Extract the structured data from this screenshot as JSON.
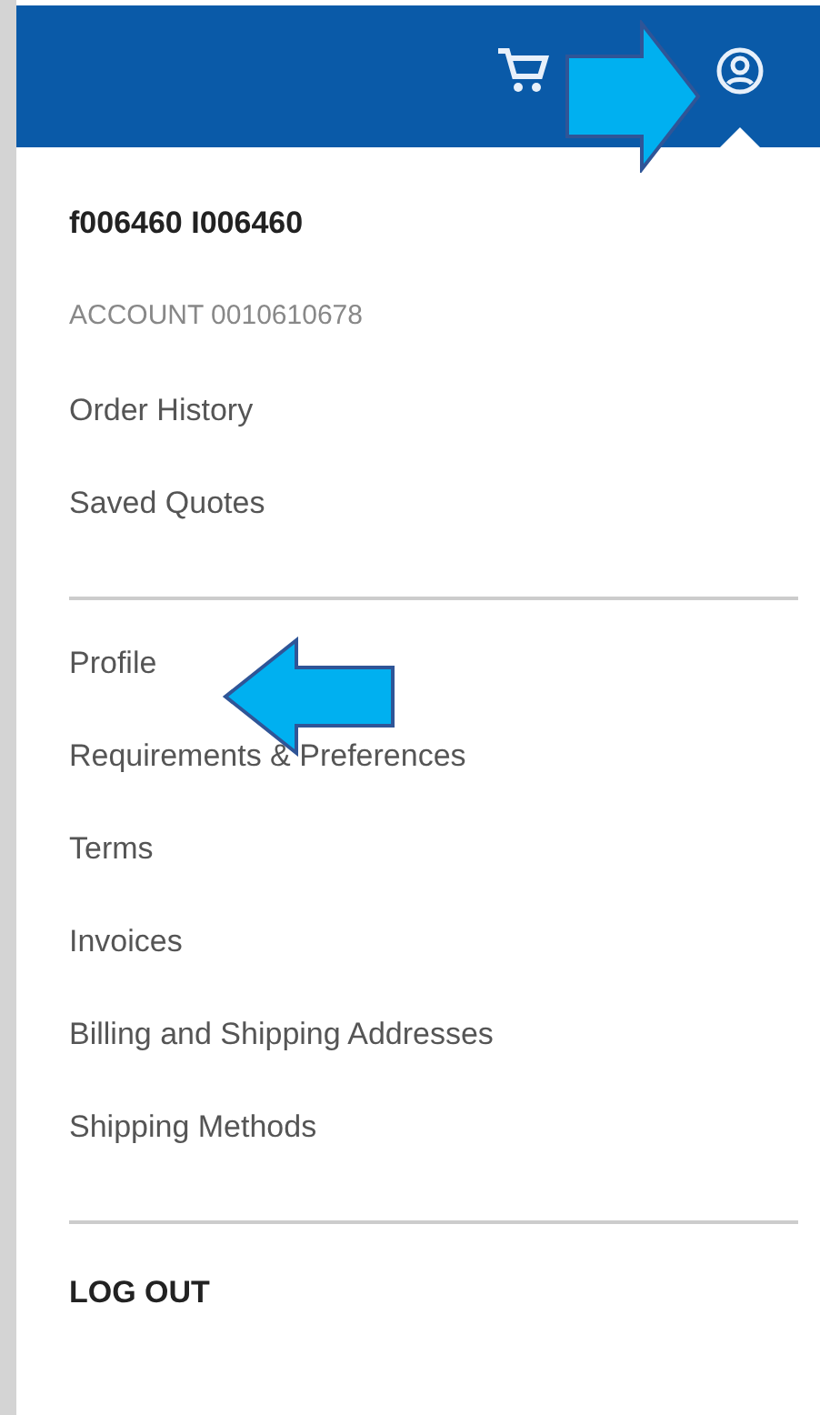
{
  "account_menu": {
    "user_name": "f006460 I006460",
    "account": "ACCOUNT 0010610678",
    "sections": [
      {
        "items": [
          "Order History",
          "Saved Quotes"
        ]
      },
      {
        "items": [
          "Profile",
          "Requirements & Preferences",
          "Terms",
          "Invoices",
          "Billing and Shipping Addresses",
          "Shipping Methods"
        ]
      }
    ],
    "logout": "LOG OUT"
  }
}
